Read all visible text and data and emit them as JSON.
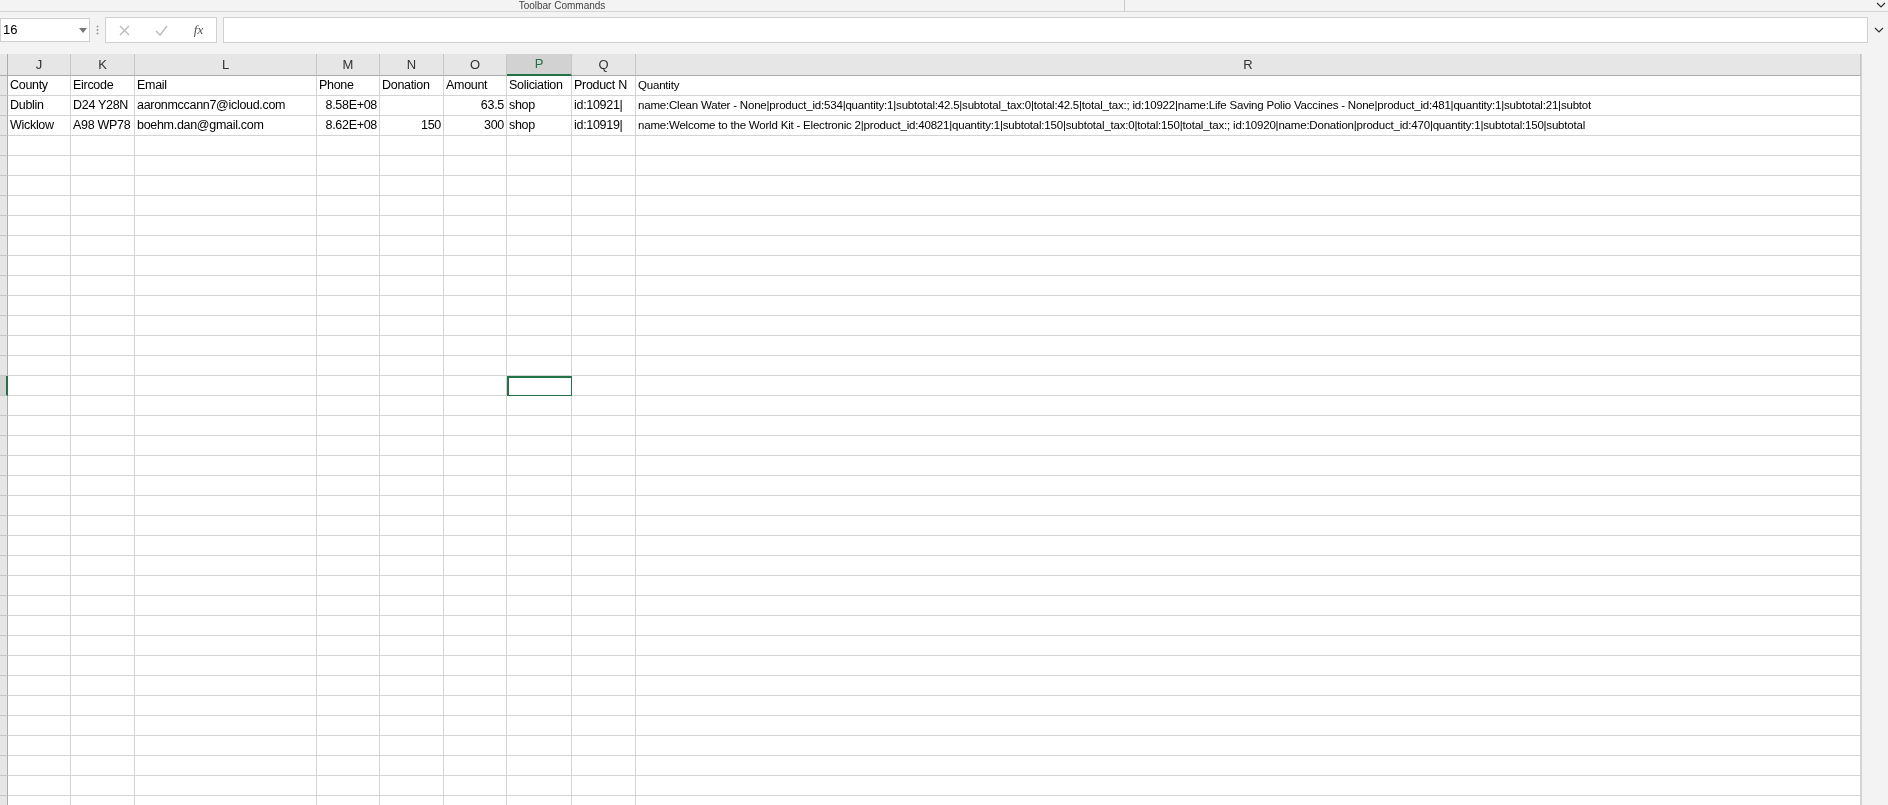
{
  "toolbar": {
    "title": "Toolbar Commands"
  },
  "formula_bar": {
    "name_box": "16",
    "function_label": "fx"
  },
  "columns": [
    {
      "label": "J",
      "selected": false
    },
    {
      "label": "K",
      "selected": false
    },
    {
      "label": "L",
      "selected": false
    },
    {
      "label": "M",
      "selected": false
    },
    {
      "label": "N",
      "selected": false
    },
    {
      "label": "O",
      "selected": false
    },
    {
      "label": "P",
      "selected": true
    },
    {
      "label": "Q",
      "selected": false
    },
    {
      "label": "R",
      "selected": false
    }
  ],
  "rows": [
    {
      "selected": false,
      "cells": [
        {
          "text": "County",
          "kind": "text"
        },
        {
          "text": "Eircode",
          "kind": "text"
        },
        {
          "text": "Email",
          "kind": "text"
        },
        {
          "text": "Phone",
          "kind": "text"
        },
        {
          "text": "Donation",
          "kind": "text"
        },
        {
          "text": "Amount",
          "kind": "text"
        },
        {
          "text": "Soliciation",
          "kind": "text"
        },
        {
          "text": "Product N",
          "kind": "text"
        },
        {
          "text": "Quantity",
          "kind": "text"
        }
      ]
    },
    {
      "selected": false,
      "cells": [
        {
          "text": "Dublin",
          "kind": "text"
        },
        {
          "text": "D24 Y28N",
          "kind": "text"
        },
        {
          "text": "aaronmccann7@icloud.com",
          "kind": "text"
        },
        {
          "text": "8.58E+08",
          "kind": "number"
        },
        {
          "kind": "empty"
        },
        {
          "text": "63.5",
          "kind": "number"
        },
        {
          "text": "shop",
          "kind": "text"
        },
        {
          "text": "id:10921|",
          "kind": "text"
        },
        {
          "text": "name:Clean Water - None|product_id:534|quantity:1|subtotal:42.5|subtotal_tax:0|total:42.5|total_tax:;  id:10922|name:Life Saving Polio Vaccines - None|product_id:481|quantity:1|subtotal:21|subtot",
          "kind": "text"
        }
      ]
    },
    {
      "selected": false,
      "cells": [
        {
          "text": "Wicklow",
          "kind": "text"
        },
        {
          "text": "A98 WP78",
          "kind": "text"
        },
        {
          "text": "boehm.dan@gmail.com",
          "kind": "text"
        },
        {
          "text": "8.62E+08",
          "kind": "number"
        },
        {
          "text": "150",
          "kind": "number"
        },
        {
          "text": "300",
          "kind": "number"
        },
        {
          "text": "shop",
          "kind": "text"
        },
        {
          "text": "id:10919|",
          "kind": "text"
        },
        {
          "text": "name:Welcome to the World Kit - Electronic 2|product_id:40821|quantity:1|subtotal:150|subtotal_tax:0|total:150|total_tax:;  id:10920|name:Donation|product_id:470|quantity:1|subtotal:150|subtotal",
          "kind": "text"
        }
      ]
    },
    {
      "selected": false
    },
    {
      "selected": false
    },
    {
      "selected": false
    },
    {
      "selected": false
    },
    {
      "selected": false
    },
    {
      "selected": false
    },
    {
      "selected": false
    },
    {
      "selected": false
    },
    {
      "selected": false
    },
    {
      "selected": false
    },
    {
      "selected": false
    },
    {
      "selected": false
    },
    {
      "selected": true
    },
    {
      "selected": false
    },
    {
      "selected": false
    },
    {
      "selected": false
    },
    {
      "selected": false
    },
    {
      "selected": false
    },
    {
      "selected": false
    },
    {
      "selected": false
    },
    {
      "selected": false
    },
    {
      "selected": false
    },
    {
      "selected": false
    },
    {
      "selected": false
    },
    {
      "selected": false
    },
    {
      "selected": false
    },
    {
      "selected": false
    },
    {
      "selected": false
    },
    {
      "selected": false
    },
    {
      "selected": false
    },
    {
      "selected": false
    },
    {
      "selected": false
    },
    {
      "selected": false
    },
    {
      "selected": false
    }
  ]
}
